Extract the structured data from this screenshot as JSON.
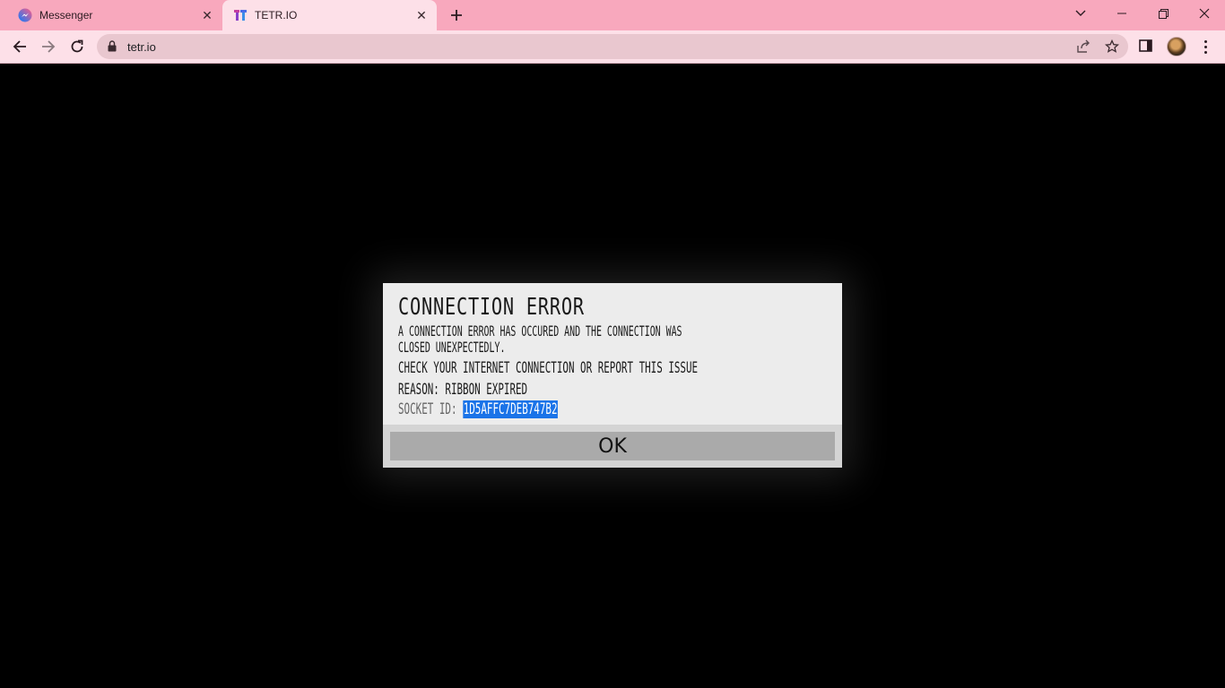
{
  "tabs": [
    {
      "title": "Messenger",
      "favicon": "messenger-icon"
    },
    {
      "title": "TETR.IO",
      "favicon": "tetrio-icon",
      "active": true
    }
  ],
  "address_bar": {
    "url": "tetr.io"
  },
  "dialog": {
    "title": "CONNECTION ERROR",
    "message_line1": "A CONNECTION ERROR HAS OCCURED AND THE CONNECTION WAS",
    "message_line2": "CLOSED UNEXPECTEDLY.",
    "check_text": "CHECK YOUR INTERNET CONNECTION OR REPORT THIS ISSUE",
    "reason_text": "REASON: RIBBON EXPIRED",
    "socket_label": "SOCKET ID: ",
    "socket_id": "1D5AFFC7DEB747B2",
    "ok_label": "OK"
  },
  "colors": {
    "tabstrip": "#f8a8bd",
    "toolbar": "#fde0e8",
    "selection": "#1a73e8"
  }
}
